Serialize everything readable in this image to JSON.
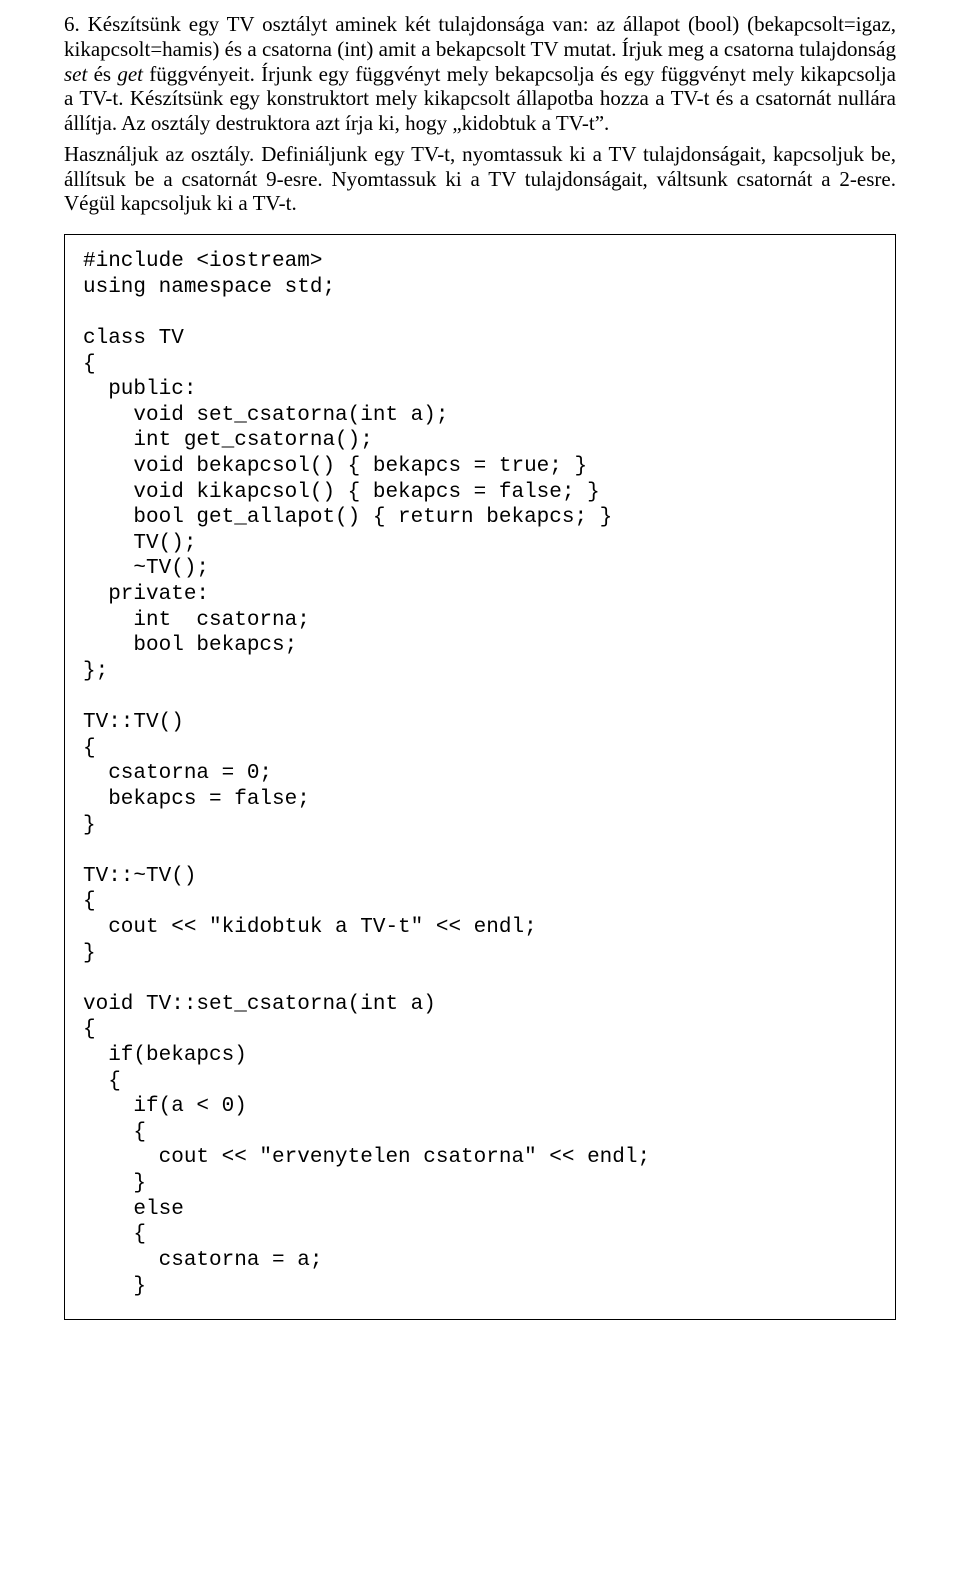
{
  "narrative": {
    "p1_a": "6. Készítsünk egy TV osztályt aminek két tulajdonsága van: az állapot (bool) (bekapcsolt=igaz, kikapcsolt=hamis) és a csatorna (int) amit a bekapcsolt TV mutat. Írjuk meg a csatorna tulajdonság ",
    "p1_set": "set",
    "p1_b": " és ",
    "p1_get": "get",
    "p1_c": " függvényeit. Írjunk egy függvényt mely bekapcsolja és egy függvényt mely kikapcsolja a TV-t. Készítsünk egy konstruktort mely kikapcsolt állapotba hozza a TV-t és a csatornát nullára állítja. Az osztály destruktora azt írja ki, hogy „kidobtuk a TV-t”.",
    "p2": "Használjuk az osztály. Definiáljunk egy TV-t, nyomtassuk ki a TV tulajdonságait, kapcsoljuk be, állítsuk be a csatornát 9-esre. Nyomtassuk ki a TV tulajdonságait, váltsunk csatornát a 2-esre. Végül kapcsoljuk ki a TV-t."
  },
  "code": "#include <iostream>\nusing namespace std;\n\nclass TV\n{\n  public:\n    void set_csatorna(int a);\n    int get_csatorna();\n    void bekapcsol() { bekapcs = true; }\n    void kikapcsol() { bekapcs = false; }\n    bool get_allapot() { return bekapcs; }\n    TV();\n    ~TV();\n  private:\n    int  csatorna;\n    bool bekapcs;\n};\n\nTV::TV()\n{\n  csatorna = 0;\n  bekapcs = false;\n}\n\nTV::~TV()\n{\n  cout << \"kidobtuk a TV-t\" << endl;\n}\n\nvoid TV::set_csatorna(int a)\n{\n  if(bekapcs)\n  {\n    if(a < 0)\n    {\n      cout << \"ervenytelen csatorna\" << endl;\n    }\n    else\n    {\n      csatorna = a;\n    }"
}
